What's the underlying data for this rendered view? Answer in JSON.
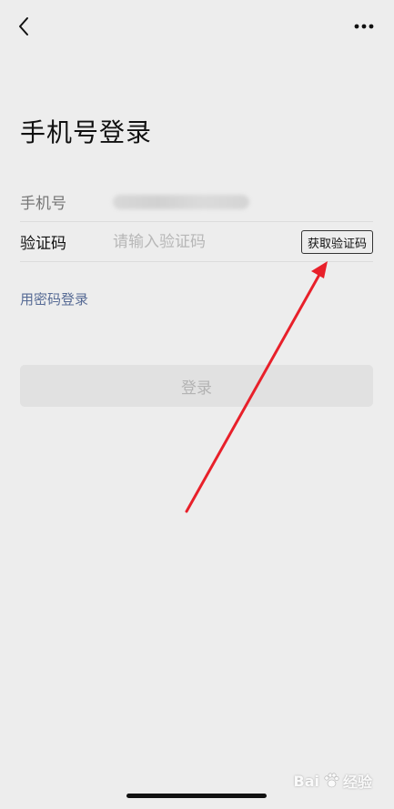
{
  "nav": {
    "back_icon": "chevron-left-icon",
    "more_icon": "more-horizontal-icon"
  },
  "page": {
    "title": "手机号登录"
  },
  "form": {
    "phone_label": "手机号",
    "code_label": "验证码",
    "code_placeholder": "请输入验证码",
    "get_code_label": "获取验证码"
  },
  "links": {
    "password_login": "用密码登录"
  },
  "actions": {
    "login_label": "登录"
  },
  "watermark": {
    "brand": "Bai",
    "suffix": "经验"
  },
  "colors": {
    "background": "#ededed",
    "link": "#576b95",
    "annotation_arrow": "#e8202a",
    "login_disabled_bg": "#e1e1e1"
  }
}
